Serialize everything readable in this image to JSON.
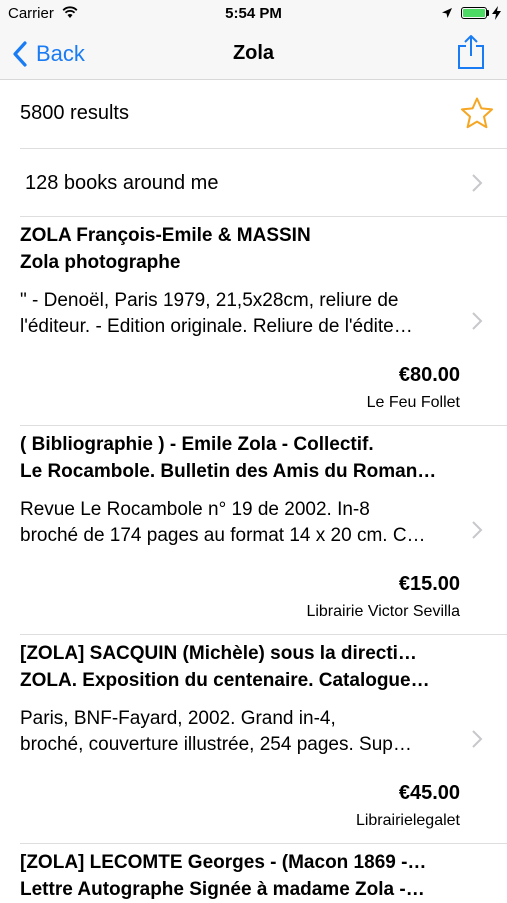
{
  "status_bar": {
    "carrier": "Carrier",
    "time": "5:54 PM",
    "battery_level": 1.0,
    "battery_color": "#4cd964",
    "icons": [
      "wifi-icon",
      "location-arrow-icon",
      "battery-icon",
      "charging-bolt-icon"
    ]
  },
  "nav": {
    "back_label": "Back",
    "title": "Zola",
    "accent": "#1a7cf4",
    "icons": [
      "chevron-left-icon",
      "share-icon"
    ]
  },
  "summary": {
    "results": "5800 results",
    "star_color": "#f5a623"
  },
  "nearby": {
    "label": "128 books around me"
  },
  "books": [
    {
      "title1": " ZOLA François-Emile & MASSIN",
      "title2": "Zola photographe",
      "desc1": "\" - Denoël, Paris 1979, 21,5x28cm, reliure de",
      "desc2": "l'éditeur. - Edition originale. Reliure de l'édite…",
      "price": "€80.00",
      "seller": "Le Feu Follet"
    },
    {
      "title1": "( Bibliographie ) - Emile Zola - Collectif.",
      "title2": "Le Rocambole. Bulletin des Amis du Roman…",
      "desc1": "      Revue Le Rocambole n° 19 de 2002. In-8",
      "desc2": "broché de 174 pages au format 14 x 20 cm. C…",
      "price": "€15.00",
      "seller": "Librairie Victor Sevilla"
    },
    {
      "title1": "[ZOLA]   SACQUIN (Michèle) sous la directi…",
      "title2": "ZOLA. Exposition du centenaire. Catalogue…",
      "desc1": "      Paris, BNF-Fayard, 2002. Grand in-4,",
      "desc2": "broché, couverture illustrée, 254 pages.  Sup…",
      "price": "€45.00",
      "seller": "Librairielegalet"
    },
    {
      "title1": "[ZOLA] LECOMTE Georges - (Macon 1869 -…",
      "title2": "Lettre Autographe Signée à madame Zola -…",
      "desc1": "",
      "desc2": "",
      "price": "",
      "seller": ""
    }
  ]
}
